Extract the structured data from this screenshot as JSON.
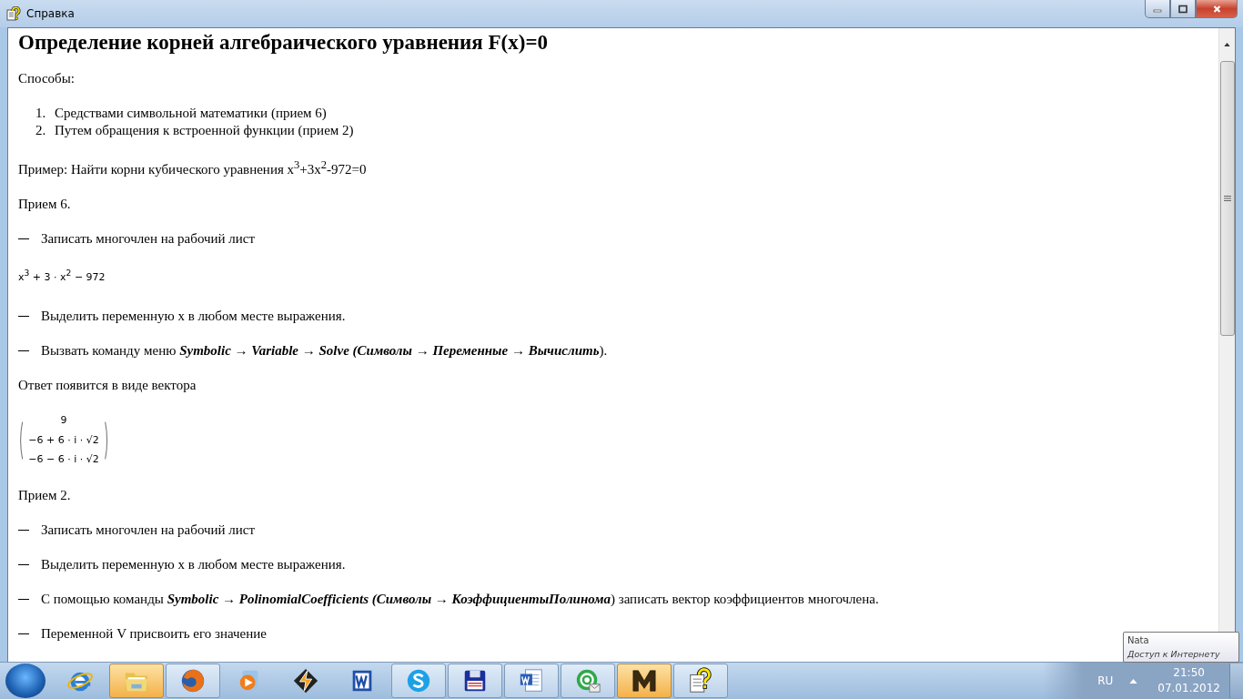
{
  "window": {
    "title": "Справка"
  },
  "content": [
    {
      "kind": "heading",
      "text": "Определение корней алгебраического уравнения F(x)=0"
    },
    {
      "kind": "para",
      "text": "Способы:"
    },
    {
      "kind": "list",
      "items": [
        {
          "number": "1.",
          "text": "Средствами символьной математики (прием 6)"
        },
        {
          "number": "2.",
          "text": "Путем обращения к встроенной функции (прием 2)"
        }
      ]
    },
    {
      "kind": "para",
      "text": "Пример: Найти корни кубического уравнения x$^{3}$+3x$^{2}$-972=0"
    },
    {
      "kind": "para",
      "text": "Прием 6."
    },
    {
      "kind": "dash",
      "parts": [
        {
          "text": "Записать многочлен на рабочий лист",
          "emph": false
        }
      ]
    },
    {
      "kind": "math",
      "text": "x$^{3}$ + 3 · x$^{2}$ − 972"
    },
    {
      "kind": "dash",
      "parts": [
        {
          "text": "Выделить переменную x в любом месте выражения.",
          "emph": false
        }
      ]
    },
    {
      "kind": "dash",
      "parts": [
        {
          "text": "Вызвать команду меню ",
          "emph": false
        },
        {
          "text": "Symbolic  → Variable  → Solve (Символы  → Переменные  → Вычислить",
          "emph": true
        },
        {
          "text": ").",
          "emph": false
        }
      ]
    },
    {
      "kind": "para",
      "text": "Ответ появится в виде вектора"
    },
    {
      "kind": "vector",
      "rows": [
        "9",
        "−6 + 6 · i · √2",
        "−6 − 6 · i · √2"
      ]
    },
    {
      "kind": "para",
      "text": "Прием 2."
    },
    {
      "kind": "dash",
      "parts": [
        {
          "text": "Записать многочлен на рабочий лист",
          "emph": false
        }
      ]
    },
    {
      "kind": "dash",
      "parts": [
        {
          "text": "Выделить переменную x в любом месте выражения.",
          "emph": false
        }
      ]
    },
    {
      "kind": "dash",
      "parts": [
        {
          "text": "С помощью команды ",
          "emph": false
        },
        {
          "text": "Symbolic  → PolinomialCoefficients (Символы  → КоэффициентыПолинома",
          "emph": true
        },
        {
          "text": ") записать вектор коэффициентов многочлена.",
          "emph": false
        }
      ]
    },
    {
      "kind": "dash",
      "parts": [
        {
          "text": "Переменной V присвоить его значение",
          "emph": false
        }
      ]
    }
  ],
  "taskbar": {
    "items": [
      {
        "kind": "ie",
        "running": false,
        "flashing": false
      },
      {
        "kind": "explorer",
        "running": true,
        "flashing": true
      },
      {
        "kind": "firefox",
        "running": true,
        "flashing": false
      },
      {
        "kind": "media",
        "running": false,
        "flashing": false
      },
      {
        "kind": "winamp",
        "running": false,
        "flashing": false
      },
      {
        "kind": "word-old",
        "running": false,
        "flashing": false
      },
      {
        "kind": "skype",
        "running": true,
        "flashing": false
      },
      {
        "kind": "save",
        "running": true,
        "flashing": false
      },
      {
        "kind": "word",
        "running": true,
        "flashing": false
      },
      {
        "kind": "mail",
        "running": true,
        "flashing": false
      },
      {
        "kind": "mathcad",
        "running": true,
        "flashing": true
      },
      {
        "kind": "help",
        "running": true,
        "flashing": false
      }
    ],
    "language": "RU",
    "time": "21:50",
    "date": "07.01.2012"
  },
  "tooltip": {
    "title": "Nata",
    "text": "Доступ к Интернету"
  }
}
